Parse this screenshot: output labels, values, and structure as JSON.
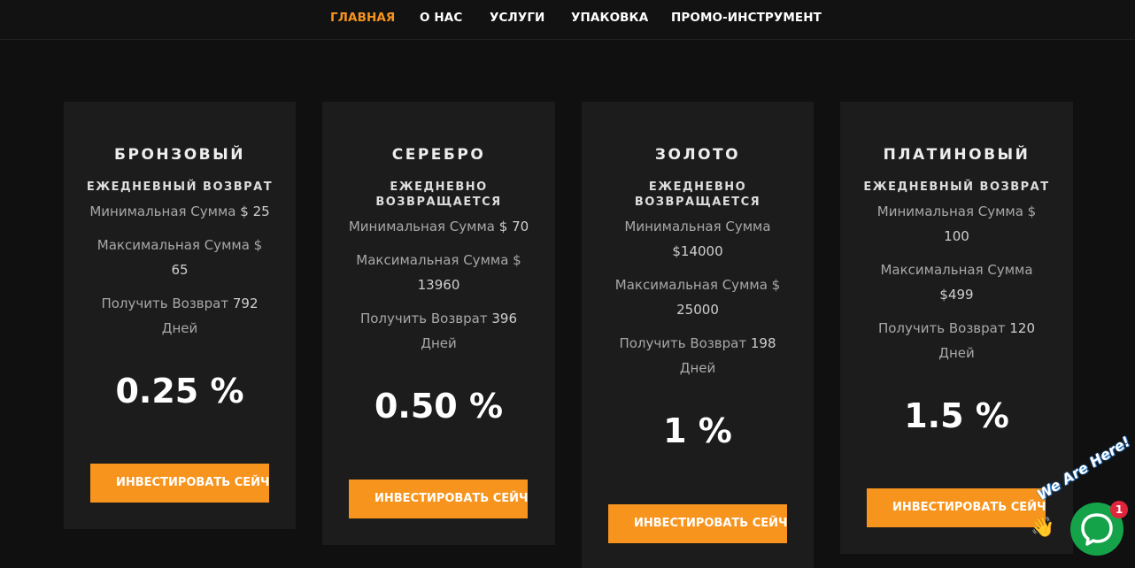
{
  "nav": {
    "items": [
      {
        "label": "ГЛАВНАЯ",
        "active": true
      },
      {
        "label": "О НАС",
        "active": false
      },
      {
        "label": "УСЛУГИ",
        "active": false
      },
      {
        "label": "УПАКОВКА",
        "active": false
      },
      {
        "label": "ПРОМО-ИНСТРУМЕНТ",
        "active": false
      }
    ]
  },
  "plans": [
    {
      "title": "БРОНЗОВЫЙ",
      "subtitle": "ЕЖЕДНЕВНЫЙ ВОЗВРАТ",
      "min_label": "Минимальная Сумма",
      "min_value": "$ 25",
      "max_label": "Максимальная Сумма $",
      "max_value": "65",
      "return_label": "Получить Возврат",
      "return_value": "792",
      "return_unit": "Дней",
      "rate": "0.25 %",
      "button": "ИНВЕСТИРОВАТЬ СЕЙЧАС"
    },
    {
      "title": "СЕРЕБРО",
      "subtitle": "ЕЖЕДНЕВНО ВОЗВРАЩАЕТСЯ",
      "min_label": "Минимальная Сумма",
      "min_value": "$ 70",
      "max_label": "Максимальная Сумма $",
      "max_value": "13960",
      "return_label": "Получить Возврат",
      "return_value": "396",
      "return_unit": "Дней",
      "rate": "0.50 %",
      "button": "ИНВЕСТИРОВАТЬ СЕЙЧАС"
    },
    {
      "title": "ЗОЛОТО",
      "subtitle": "ЕЖЕДНЕВНО ВОЗВРАЩАЕТСЯ",
      "min_label": "Минимальная Сумма",
      "min_value": "$14000",
      "max_label": "Максимальная Сумма $",
      "max_value": "25000",
      "return_label": "Получить Возврат",
      "return_value": "198",
      "return_unit": "Дней",
      "rate": "1 %",
      "button": "ИНВЕСТИРОВАТЬ СЕЙЧАС"
    },
    {
      "title": "ПЛАТИНОВЫЙ",
      "subtitle": "ЕЖЕДНЕВНЫЙ ВОЗВРАТ",
      "min_label": "Минимальная Сумма $",
      "min_value": "100",
      "max_label": "Максимальная Сумма",
      "max_value": "$499",
      "return_label": "Получить Возврат",
      "return_value": "120",
      "return_unit": "Дней",
      "rate": "1.5 %",
      "button": "ИНВЕСТИРОВАТЬ СЕЙЧАС"
    }
  ],
  "chat": {
    "banner": "We Are Here!",
    "badge_count": "1",
    "wave_icon": "waving-hand-icon",
    "bubble_icon": "chat-bubble-icon"
  },
  "colors": {
    "accent": "#f7941d",
    "background": "#101010",
    "card": "#1c1c1c",
    "chat_green": "#15a34a",
    "badge_red": "#e0243c"
  }
}
